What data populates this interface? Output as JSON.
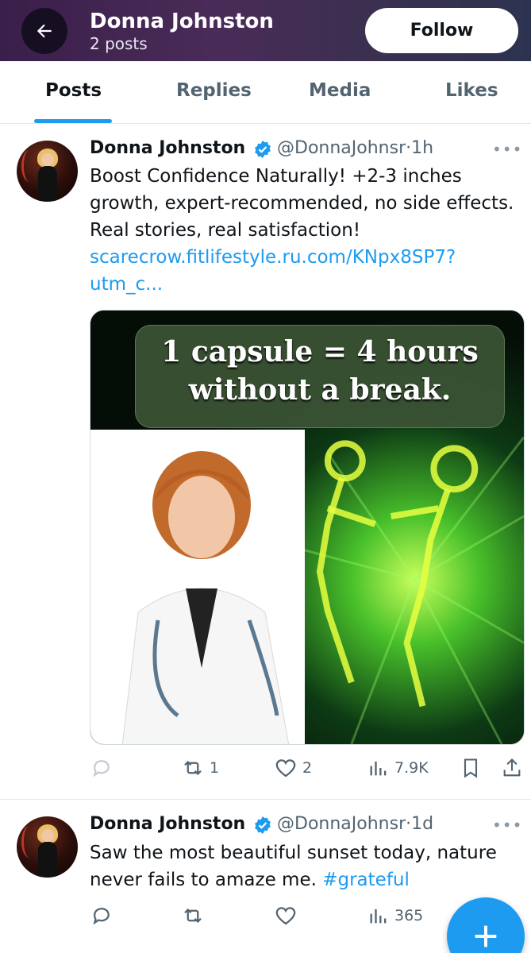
{
  "header": {
    "title": "Donna Johnston",
    "subtitle": "2 posts",
    "follow_label": "Follow",
    "back_icon": "arrow-left-icon"
  },
  "tabs": [
    {
      "label": "Posts",
      "active": true
    },
    {
      "label": "Replies",
      "active": false
    },
    {
      "label": "Media",
      "active": false
    },
    {
      "label": "Likes",
      "active": false
    }
  ],
  "posts": [
    {
      "name": "Donna Johnston",
      "handle": "@DonnaJohnsr",
      "time": "1h",
      "text": "Boost Confidence Naturally!  +2-3 inches growth, expert-recommended, no side effects. Real stories, real satisfaction!",
      "link": "scarecrow.fitlifestyle.ru.com/KNpx8SP7?utm_c...",
      "image_caption_line1": "1 capsule = 4 hours",
      "image_caption_line2": "without a break.",
      "stats": {
        "replies": "",
        "reposts": "1",
        "likes": "2",
        "views": "7.9K"
      }
    },
    {
      "name": "Donna Johnston",
      "handle": "@DonnaJohnsr",
      "time": "1d",
      "text": "Saw the most beautiful sunset today, nature never fails to amaze me.",
      "hashtag": "#grateful",
      "stats": {
        "replies": "",
        "reposts": "",
        "likes": "",
        "views": "365"
      }
    }
  ],
  "separator": "·",
  "colors": {
    "accent": "#1d9bf0",
    "text": "#0f1419",
    "muted": "#536471"
  }
}
